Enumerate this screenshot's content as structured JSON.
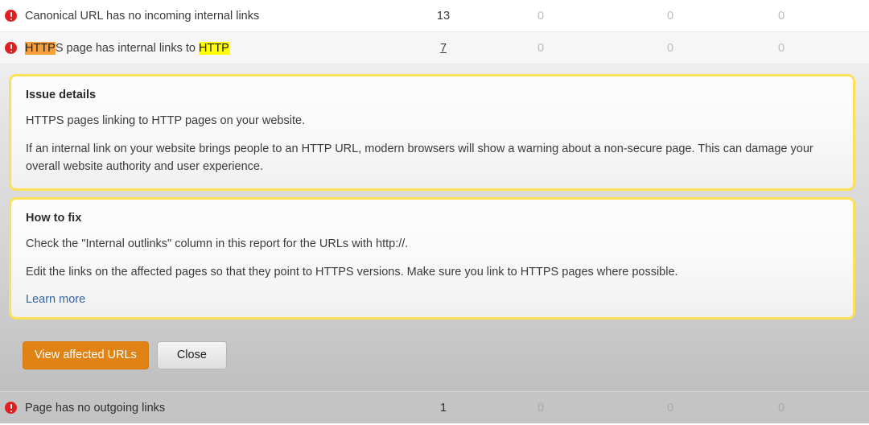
{
  "rows": [
    {
      "icon": "error-icon",
      "title": "Canonical URL has no incoming internal links",
      "title_parts": [
        {
          "text": "Canonical URL has no incoming internal links",
          "highlight": "none"
        }
      ],
      "counts": [
        "13",
        "0",
        "0",
        "0"
      ],
      "first_count_is_link": false,
      "selected": false
    },
    {
      "icon": "error-icon",
      "title": "HTTPS page has internal links to HTTP",
      "title_parts": [
        {
          "text": "HTTP",
          "highlight": "orange"
        },
        {
          "text": "S page has internal links to ",
          "highlight": "none"
        },
        {
          "text": "HTTP",
          "highlight": "yellow"
        }
      ],
      "counts": [
        "7",
        "0",
        "0",
        "0"
      ],
      "first_count_is_link": true,
      "selected": true
    }
  ],
  "detail": {
    "issue_details": {
      "title": "Issue details",
      "paragraphs": [
        "HTTPS pages linking to HTTP pages on your website.",
        "If an internal link on your website brings people to an HTTP URL, modern browsers will show a warning about a non-secure page. This can damage your overall website authority and user experience."
      ]
    },
    "how_to_fix": {
      "title": "How to fix",
      "paragraphs": [
        "Check the \"Internal outlinks\" column in this report for the URLs with http://.",
        "Edit the links on the affected pages so that they point to HTTPS versions. Make sure you link to HTTPS pages where possible."
      ],
      "learn_more_label": "Learn more"
    },
    "actions": {
      "primary_label": "View affected URLs",
      "secondary_label": "Close"
    }
  },
  "bottom_row": {
    "icon": "error-icon",
    "title": "Page has no outgoing links",
    "counts": [
      "1",
      "0",
      "0",
      "0"
    ]
  },
  "colors": {
    "error_red": "#e02020",
    "box_border_yellow": "#fbe158",
    "highlight_orange": "#f6a03c",
    "highlight_yellow": "#ffff00",
    "primary_button_orange": "#e08214",
    "link_blue": "#3465a4"
  }
}
